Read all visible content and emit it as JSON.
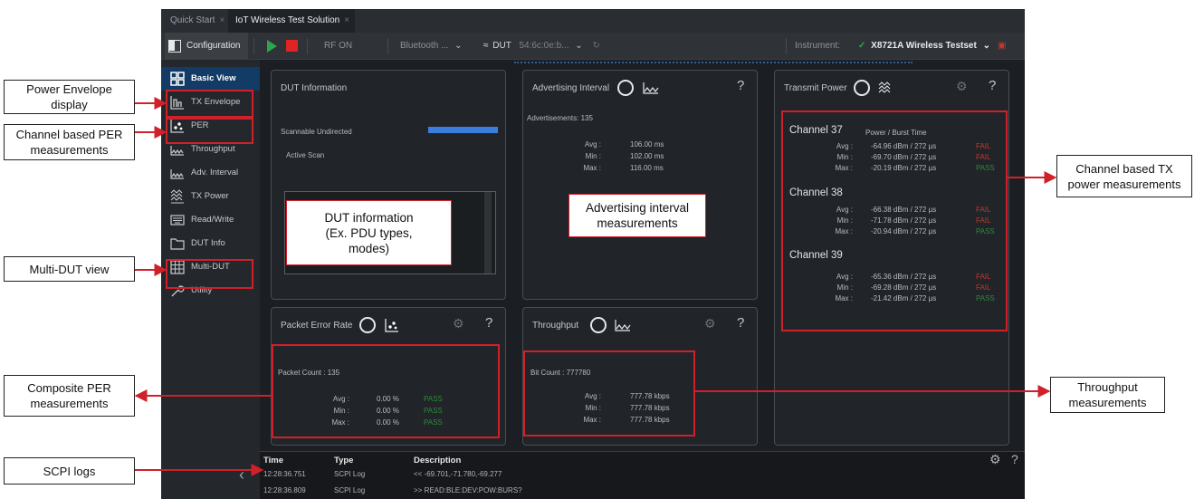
{
  "tabs": [
    {
      "label": "Quick Start"
    },
    {
      "label": "IoT Wireless Test Solution"
    }
  ],
  "toolbar": {
    "configuration": "Configuration",
    "rf_on": "RF ON",
    "protocol": "Bluetooth ...",
    "dut_label": "DUT",
    "dut_address": "54:6c:0e:b...",
    "instrument_label": "Instrument:",
    "instrument_value": "X8721A Wireless Testset"
  },
  "sidebar": {
    "items": [
      {
        "label": "Basic View",
        "icon": "grid-icon",
        "active": true
      },
      {
        "label": "TX Envelope",
        "icon": "envelope-chart-icon"
      },
      {
        "label": "PER",
        "icon": "scatter-icon"
      },
      {
        "label": "Throughput",
        "icon": "waveform-icon"
      },
      {
        "label": "Adv. Interval",
        "icon": "waveform-icon"
      },
      {
        "label": "TX Power",
        "icon": "power-chart-icon"
      },
      {
        "label": "Read/Write",
        "icon": "keyboard-icon"
      },
      {
        "label": "DUT Info",
        "icon": "folder-icon"
      },
      {
        "label": "Multi-DUT",
        "icon": "table-icon"
      },
      {
        "label": "Utility",
        "icon": "wrench-icon"
      }
    ]
  },
  "dut_info": {
    "title": "DUT Information",
    "mode": "Scannable Undirected",
    "scan": "Active Scan",
    "callout": "DUT information\n(Ex. PDU types,\nmodes)"
  },
  "adv_interval": {
    "title": "Advertising Interval",
    "count": "Advertisements: 135",
    "rows": [
      {
        "label": "Avg :",
        "value": "106.00 ms"
      },
      {
        "label": "Min :",
        "value": "102.00 ms"
      },
      {
        "label": "Max :",
        "value": "116.00 ms"
      }
    ],
    "callout": "Advertising interval\nmeasurements"
  },
  "tx_power": {
    "title": "Transmit Power",
    "header": "Power / Burst Time",
    "channels": [
      {
        "name": "Channel 37",
        "rows": [
          {
            "label": "Avg :",
            "value": "-64.96 dBm / 272 µs",
            "status": "FAIL"
          },
          {
            "label": "Min :",
            "value": "-69.70 dBm / 272 µs",
            "status": "FAIL"
          },
          {
            "label": "Max :",
            "value": "-20.19 dBm / 272 µs",
            "status": "PASS"
          }
        ]
      },
      {
        "name": "Channel 38",
        "rows": [
          {
            "label": "Avg :",
            "value": "-66.38 dBm / 272 µs",
            "status": "FAIL"
          },
          {
            "label": "Min :",
            "value": "-71.78 dBm / 272 µs",
            "status": "FAIL"
          },
          {
            "label": "Max :",
            "value": "-20.94 dBm / 272 µs",
            "status": "PASS"
          }
        ]
      },
      {
        "name": "Channel 39",
        "rows": [
          {
            "label": "Avg :",
            "value": "-65.36 dBm / 272 µs",
            "status": "FAIL"
          },
          {
            "label": "Min :",
            "value": "-69.28 dBm / 272 µs",
            "status": "FAIL"
          },
          {
            "label": "Max :",
            "value": "-21.42 dBm / 272 µs",
            "status": "PASS"
          }
        ]
      }
    ]
  },
  "per": {
    "title": "Packet Error Rate",
    "count": "Packet Count : 135",
    "rows": [
      {
        "label": "Avg :",
        "value": "0.00 %",
        "status": "PASS"
      },
      {
        "label": "Min :",
        "value": "0.00 %",
        "status": "PASS"
      },
      {
        "label": "Max :",
        "value": "0.00 %",
        "status": "PASS"
      }
    ]
  },
  "throughput": {
    "title": "Throughput",
    "count": "Bit Count : 777780",
    "rows": [
      {
        "label": "Avg :",
        "value": "777.78 kbps"
      },
      {
        "label": "Min :",
        "value": "777.78 kbps"
      },
      {
        "label": "Max :",
        "value": "777.78 kbps"
      }
    ]
  },
  "logs": {
    "headers": [
      "Time",
      "Type",
      "Description"
    ],
    "rows": [
      {
        "time": "12:28:36.751",
        "type": "SCPI Log",
        "desc": "<< -69.701,-71.780,-69.277"
      },
      {
        "time": "12:28:36.809",
        "type": "SCPI Log",
        "desc": ">> READ:BLE:DEV:POW:BURS?"
      }
    ]
  },
  "annotations": {
    "power_envelope": "Power Envelope\ndisplay",
    "channel_per": "Channel based PER\nmeasurements",
    "multi_dut": "Multi-DUT view",
    "composite_per": "Composite PER\nmeasurements",
    "scpi_logs": "SCPI logs",
    "channel_tx": "Channel based TX\npower measurements",
    "throughput": "Throughput\nmeasurements"
  },
  "colors": {
    "accent_blue": "#123b66",
    "fail": "#c0392b",
    "pass": "#2e8b3a",
    "annotation_red": "#d0202a"
  }
}
